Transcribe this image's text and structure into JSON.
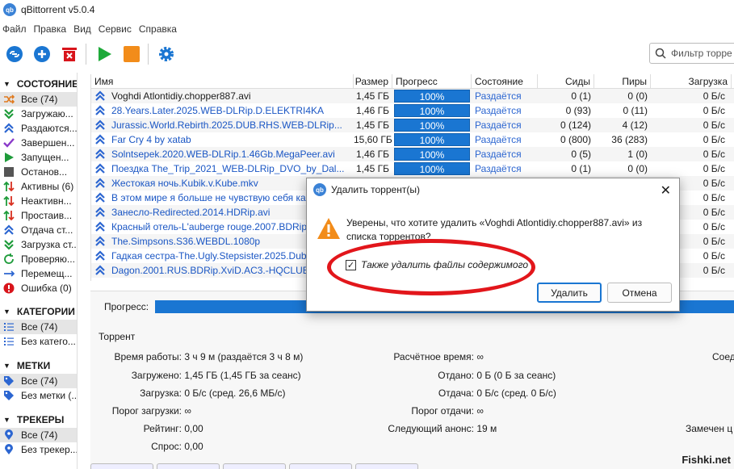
{
  "title": "qBittorrent v5.0.4",
  "app_icon": "qb",
  "menu": [
    "Файл",
    "Правка",
    "Вид",
    "Сервис",
    "Справка"
  ],
  "filter_placeholder": "Фильтр торре",
  "sidebar": {
    "status_header": "СОСТОЯНИЕ",
    "status_items": [
      {
        "label": "Все (74)",
        "icon": "shuffle-icon",
        "color": "#e07a1f"
      },
      {
        "label": "Загружаю...",
        "icon": "download-chevron-icon",
        "color": "#1e9b3a"
      },
      {
        "label": "Раздаются...",
        "icon": "upload-chevron-icon",
        "color": "#2c66d1"
      },
      {
        "label": "Завершен...",
        "icon": "check-icon",
        "color": "#8a3ac9"
      },
      {
        "label": "Запущен...",
        "icon": "play-icon",
        "color": "#1e9b3a"
      },
      {
        "label": "Останов...",
        "icon": "stop-icon",
        "color": "#555555"
      },
      {
        "label": "Активны (6)",
        "icon": "updown-icon",
        "color": "#d83020"
      },
      {
        "label": "Неактивн...",
        "icon": "updown-icon",
        "color": "#d83020"
      },
      {
        "label": "Простаив...",
        "icon": "updown-icon",
        "color": "#d83020"
      },
      {
        "label": "Отдача ст...",
        "icon": "upload-chevron-icon",
        "color": "#2c66d1"
      },
      {
        "label": "Загрузка ст...",
        "icon": "download-chevron-icon",
        "color": "#1e9b3a"
      },
      {
        "label": "Проверяю...",
        "icon": "refresh-icon",
        "color": "#1e9b3a"
      },
      {
        "label": "Перемещ...",
        "icon": "move-icon",
        "color": "#2c66d1"
      },
      {
        "label": "Ошибка (0)",
        "icon": "error-icon",
        "color": "#d8141b"
      }
    ],
    "categories_header": "КАТЕГОРИИ",
    "categories_items": [
      {
        "label": "Все (74)",
        "icon": "list-icon"
      },
      {
        "label": "Без катего...",
        "icon": "list-icon"
      }
    ],
    "tags_header": "МЕТКИ",
    "tags_items": [
      {
        "label": "Все (74)",
        "icon": "tag-icon"
      },
      {
        "label": "Без метки (...",
        "icon": "tag-icon"
      }
    ],
    "trackers_header": "ТРЕКЕРЫ",
    "trackers_items": [
      {
        "label": "Все (74)",
        "icon": "pin-icon"
      },
      {
        "label": "Без трекер...",
        "icon": "pin-icon"
      }
    ]
  },
  "columns": [
    "Имя",
    "Размер",
    "Прогресс",
    "Состояние",
    "Сиды",
    "Пиры",
    "Загрузка"
  ],
  "torrents": [
    {
      "name": "Voghdi Atlontidiy.chopper887.avi",
      "size": "1,45 ГБ",
      "progress": "100%",
      "state": "Раздаётся",
      "seeds": "0 (1)",
      "peers": "0 (0)",
      "dl": "0 Б/с"
    },
    {
      "name": "28.Years.Later.2025.WEB-DLRip.D.ELEKTRI4KA",
      "size": "1,46 ГБ",
      "progress": "100%",
      "state": "Раздаётся",
      "seeds": "0 (93)",
      "peers": "0 (11)",
      "dl": "0 Б/с"
    },
    {
      "name": "Jurassic.World.Rebirth.2025.DUB.RHS.WEB-DLRip...",
      "size": "1,45 ГБ",
      "progress": "100%",
      "state": "Раздаётся",
      "seeds": "0 (124)",
      "peers": "4 (12)",
      "dl": "0 Б/с"
    },
    {
      "name": "Far Cry 4 by xatab",
      "size": "15,60 ГБ",
      "progress": "100%",
      "state": "Раздаётся",
      "seeds": "0 (800)",
      "peers": "36 (283)",
      "dl": "0 Б/с"
    },
    {
      "name": "Solntsepek.2020.WEB-DLRip.1.46Gb.MegaPeer.avi",
      "size": "1,46 ГБ",
      "progress": "100%",
      "state": "Раздаётся",
      "seeds": "0 (5)",
      "peers": "1 (0)",
      "dl": "0 Б/с"
    },
    {
      "name": "Поездка The_Trip_2021_WEB-DLRip_DVO_by_Dal...",
      "size": "1,45 ГБ",
      "progress": "100%",
      "state": "Раздаётся",
      "seeds": "0 (1)",
      "peers": "0 (0)",
      "dl": "0 Б/с"
    },
    {
      "name": "Жестокая ночь.Kubik.v.Kube.mkv",
      "size": "",
      "progress": "",
      "state": "",
      "seeds": "",
      "peers": "",
      "dl": "0 Б/с"
    },
    {
      "name": "В этом мире я больше не чувствую себя как",
      "size": "",
      "progress": "",
      "state": "",
      "seeds": "",
      "peers": "",
      "dl": "0 Б/с"
    },
    {
      "name": "Занесло-Redirected.2014.HDRip.avi",
      "size": "",
      "progress": "",
      "state": "",
      "seeds": "",
      "peers": "",
      "dl": "0 Б/с"
    },
    {
      "name": "Красный отель-L'auberge rouge.2007.BDRip.",
      "size": "",
      "progress": "",
      "state": "",
      "seeds": "",
      "peers": "",
      "dl": "0 Б/с"
    },
    {
      "name": "The.Simpsons.S36.WEBDL.1080p",
      "size": "",
      "progress": "",
      "state": "",
      "seeds": "",
      "peers": "",
      "dl": "0 Б/с"
    },
    {
      "name": "Гадкая сестра-The.Ugly.Stepsister.2025.Dub.W",
      "size": "",
      "progress": "",
      "state": "",
      "seeds": "",
      "peers": "",
      "dl": "0 Б/с"
    },
    {
      "name": "Dagon.2001.RUS.BDRip.XviD.AC3.-HQCLUB.avi",
      "size": "",
      "progress": "",
      "state": "",
      "seeds": "",
      "peers": "",
      "dl": "0 Б/с"
    }
  ],
  "details": {
    "progress_label": "Прогресс:",
    "group_title": "Торрент",
    "uptime_k": "Время работы:",
    "uptime_v": "3 ч 9 м (раздаётся 3 ч 8 м)",
    "downloaded_k": "Загружено:",
    "downloaded_v": "1,45 ГБ (1,45 ГБ за сеанс)",
    "dlspeed_k": "Загрузка:",
    "dlspeed_v": "0 Б/с (сред. 26,6 МБ/с)",
    "dllimit_k": "Порог загрузки:",
    "dllimit_v": "∞",
    "rating_k": "Рейтинг:",
    "rating_v": "0,00",
    "demand_k": "Спрос:",
    "demand_v": "0,00",
    "eta_k": "Расчётное время:",
    "eta_v": "∞",
    "uploaded_k": "Отдано:",
    "uploaded_v": "0 Б (0 Б за сеанс)",
    "upspeed_k": "Отдача:",
    "upspeed_v": "0 Б/с (сред. 0 Б/с)",
    "uplimit_k": "Порог отдачи:",
    "uplimit_v": "∞",
    "announce_k": "Следующий анонс:",
    "announce_v": "19 м",
    "conn_k": "Соед",
    "lastseen_k": "Замечен ц"
  },
  "dialog": {
    "title": "Удалить торрент(ы)",
    "message": "Уверены, что хотите удалить «Voghdi Atlontidiy.chopper887.avi» из списка торрентов?",
    "checkbox_label": "Также удалить файлы содержимого",
    "checkbox_checked": true,
    "delete_label": "Удалить",
    "cancel_label": "Отмена"
  },
  "watermark": "Fishki.net",
  "colors": {
    "accent": "#1a76d2",
    "highlight": "#e2161b",
    "state_text": "#2c66d1"
  }
}
